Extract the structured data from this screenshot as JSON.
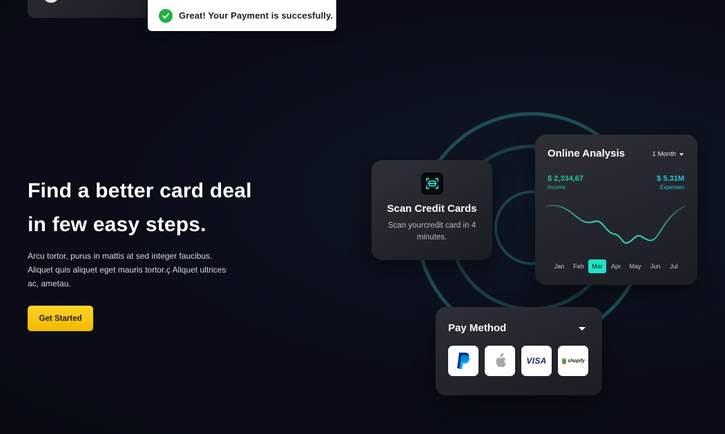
{
  "toast": {
    "message": "Great! Your Payment is succesfully.",
    "icon": "check-circle-icon",
    "color": "#1fb141"
  },
  "hero": {
    "title_line1": "Find a better card deal",
    "title_line2": "in few easy steps.",
    "description": "Arcu tortor, purus in mattis at sed integer faucibus. Aliquet quis aliquet eget mauris tortor.ç Aliquet ultrices ac, ametau.",
    "cta_label": "Get Started",
    "cta_color": "#f5c518"
  },
  "scan_card": {
    "icon": "scan-card-icon",
    "title": "Scan Credit Cards",
    "subtitle": "Scan yourcredit card in 4 minutes."
  },
  "analysis": {
    "title": "Online Analysis",
    "period": "1 Month",
    "income_value": "$ 2,334,67",
    "income_label": "Income",
    "expenses_value": "$ 5.31M",
    "expenses_label": "Expenses",
    "months": [
      "Jan",
      "Feb",
      "Mar",
      "Apr",
      "May",
      "Jun",
      "Jul"
    ],
    "active_month": "Mar",
    "accent_color": "#22e0c8"
  },
  "pay_method": {
    "title": "Pay Method",
    "methods": [
      "PayPal",
      "Apple",
      "VISA",
      "shopify"
    ]
  }
}
